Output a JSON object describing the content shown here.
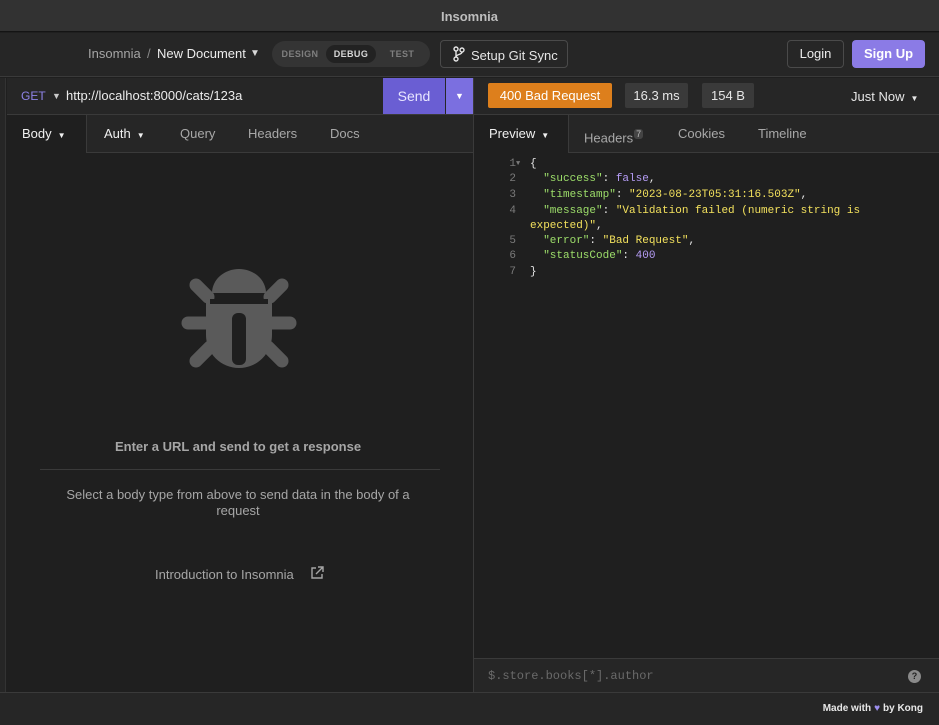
{
  "window": {
    "title": "Insomnia"
  },
  "breadcrumb": {
    "root": "Insomnia",
    "separator": "/",
    "document": "New Document"
  },
  "mode_toggle": {
    "design": "DESIGN",
    "debug": "DEBUG",
    "test": "TEST",
    "selected": "DEBUG"
  },
  "git": {
    "label": "Setup Git Sync",
    "icon": "git-branch-icon"
  },
  "auth": {
    "login": "Login",
    "signup": "Sign Up"
  },
  "request": {
    "method": "GET",
    "url": "http://localhost:8000/cats/123a",
    "send_label": "Send",
    "tabs": {
      "body": "Body",
      "auth": "Auth",
      "query": "Query",
      "headers": "Headers",
      "docs": "Docs"
    },
    "empty_title": "Enter a URL and send to get a response",
    "empty_subtitle": "Select a body type from above to send data in the body of a request",
    "intro_link": "Introduction to Insomnia"
  },
  "response": {
    "status": "400 Bad Request",
    "time": "16.3 ms",
    "size": "154 B",
    "history": "Just Now",
    "status_color": "#dd7f1c",
    "tabs": {
      "preview": "Preview",
      "headers": "Headers",
      "headers_count": "7",
      "cookies": "Cookies",
      "timeline": "Timeline"
    },
    "code_lines": [
      {
        "n": "1",
        "text": "{"
      },
      {
        "n": "2",
        "key": "\"success\"",
        "val": "false",
        "type": "n",
        "comma": ","
      },
      {
        "n": "3",
        "key": "\"timestamp\"",
        "val": "\"2023-08-23T05:31:16.503Z\"",
        "type": "s",
        "comma": ","
      },
      {
        "n": "4",
        "key": "\"message\"",
        "val": "\"Validation failed (numeric string is",
        "type": "s",
        "cont": "expected)\"",
        "comma": ","
      },
      {
        "n": "5",
        "key": "\"error\"",
        "val": "\"Bad Request\"",
        "type": "s",
        "comma": ","
      },
      {
        "n": "6",
        "key": "\"statusCode\"",
        "val": "400",
        "type": "n",
        "comma": ""
      },
      {
        "n": "7",
        "text": "}"
      }
    ],
    "filter_placeholder": "$.store.books[*].author"
  },
  "footer": {
    "made_with": "Made with",
    "by": "by Kong"
  },
  "colors": {
    "accent": "#8b7be6",
    "send": "#6a5ed3"
  }
}
